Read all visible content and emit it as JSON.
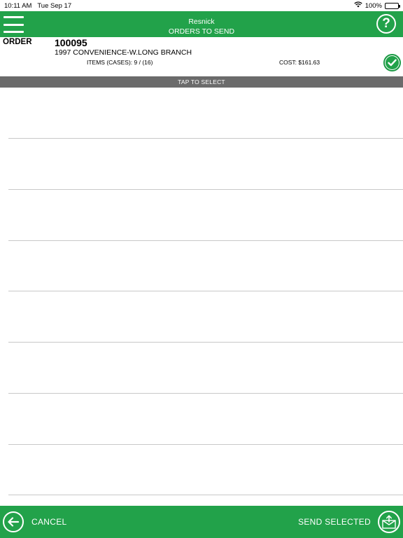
{
  "status_bar": {
    "time": "10:11 AM",
    "date": "Tue Sep 17",
    "battery": "100%",
    "icons": [
      "wifi-icon",
      "battery-icon"
    ]
  },
  "header": {
    "company": "Resnick",
    "title": "ORDERS TO SEND",
    "icons": [
      "menu-icon",
      "help-icon"
    ],
    "help_glyph": "?"
  },
  "order": {
    "label": "ORDER",
    "number": "100095",
    "customer": "1997 CONVENIENCE-W.LONG BRANCH",
    "items": "ITEMS (CASES): 9 / (16)",
    "cost": "COST: $161.63",
    "selected": true,
    "icon": "checkmark-icon"
  },
  "list": {
    "header": "TAP TO SELECT",
    "rows": 8
  },
  "footer": {
    "cancel_label": "CANCEL",
    "send_label": "SEND SELECTED",
    "icons": [
      "back-arrow-icon",
      "envelope-send-icon"
    ]
  },
  "colors": {
    "brand_green": "#22a24a",
    "bar_gray": "#6b6b6b",
    "divider": "#c8c8c8"
  }
}
